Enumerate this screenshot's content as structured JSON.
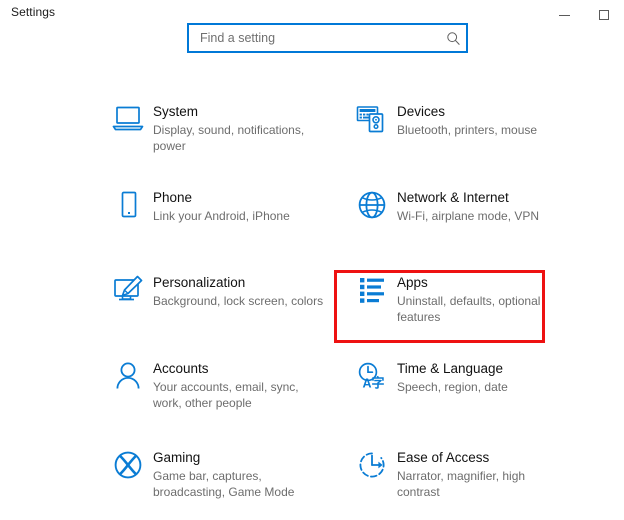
{
  "window": {
    "title": "Settings",
    "controls": [
      {
        "name": "minimize",
        "label": "–"
      },
      {
        "name": "maximize",
        "label": "□"
      }
    ]
  },
  "search": {
    "placeholder": "Find a setting",
    "value": "",
    "icon": "search-icon"
  },
  "accent_color": "#0078d7",
  "highlight_color": "#ee1111",
  "highlighted_tile": "Apps",
  "categories": [
    {
      "id": "system",
      "title": "System",
      "subtitle": "Display, sound, notifications, power",
      "icon": "laptop-icon"
    },
    {
      "id": "devices",
      "title": "Devices",
      "subtitle": "Bluetooth, printers, mouse",
      "icon": "keyboard-device-icon"
    },
    {
      "id": "phone",
      "title": "Phone",
      "subtitle": "Link your Android, iPhone",
      "icon": "phone-icon"
    },
    {
      "id": "network",
      "title": "Network & Internet",
      "subtitle": "Wi-Fi, airplane mode, VPN",
      "icon": "globe-icon"
    },
    {
      "id": "personalization",
      "title": "Personalization",
      "subtitle": "Background, lock screen, colors",
      "icon": "monitor-brush-icon"
    },
    {
      "id": "apps",
      "title": "Apps",
      "subtitle": "Uninstall, defaults, optional features",
      "icon": "list-icon"
    },
    {
      "id": "accounts",
      "title": "Accounts",
      "subtitle": "Your accounts, email, sync, work, other people",
      "icon": "person-icon"
    },
    {
      "id": "time-language",
      "title": "Time & Language",
      "subtitle": "Speech, region, date",
      "icon": "clock-language-icon"
    },
    {
      "id": "gaming",
      "title": "Gaming",
      "subtitle": "Game bar, captures, broadcasting, Game Mode",
      "icon": "xbox-icon"
    },
    {
      "id": "ease-of-access",
      "title": "Ease of Access",
      "subtitle": "Narrator, magnifier, high contrast",
      "icon": "access-clock-icon"
    }
  ]
}
